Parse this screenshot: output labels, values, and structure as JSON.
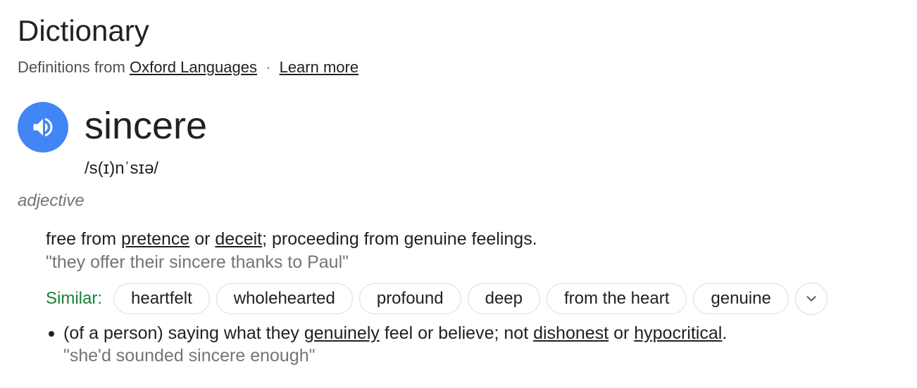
{
  "header": {
    "title": "Dictionary",
    "source_prefix": "Definitions from",
    "source_link": "Oxford Languages",
    "separator": "·",
    "learn_more": "Learn more"
  },
  "entry": {
    "word": "sincere",
    "phonetic": "/s(ɪ)nˈsɪə/",
    "part_of_speech": "adjective",
    "audio_icon": "speaker-icon"
  },
  "senses": [
    {
      "definition": {
        "t1": "free from ",
        "l1": "pretence",
        "t2": " or ",
        "l2": "deceit",
        "t3": "; proceeding from genuine feelings."
      },
      "example": "\"they offer their sincere thanks to Paul\""
    },
    {
      "definition": {
        "t1": "(of a person) saying what they ",
        "l1": "genuinely",
        "t2": " feel or believe; not ",
        "l2": "dishonest",
        "t3": " or ",
        "l3": "hypocritical",
        "t4": "."
      },
      "example": "\"she'd sounded sincere enough\""
    }
  ],
  "similar": {
    "label": "Similar:",
    "chips": [
      "heartfelt",
      "wholehearted",
      "profound",
      "deep",
      "from the heart",
      "genuine"
    ],
    "expand_icon": "chevron-down-icon"
  },
  "colors": {
    "accent": "#4285f4",
    "similar_label": "#188038",
    "example_text": "#70757a",
    "chip_border": "#dadce0"
  }
}
